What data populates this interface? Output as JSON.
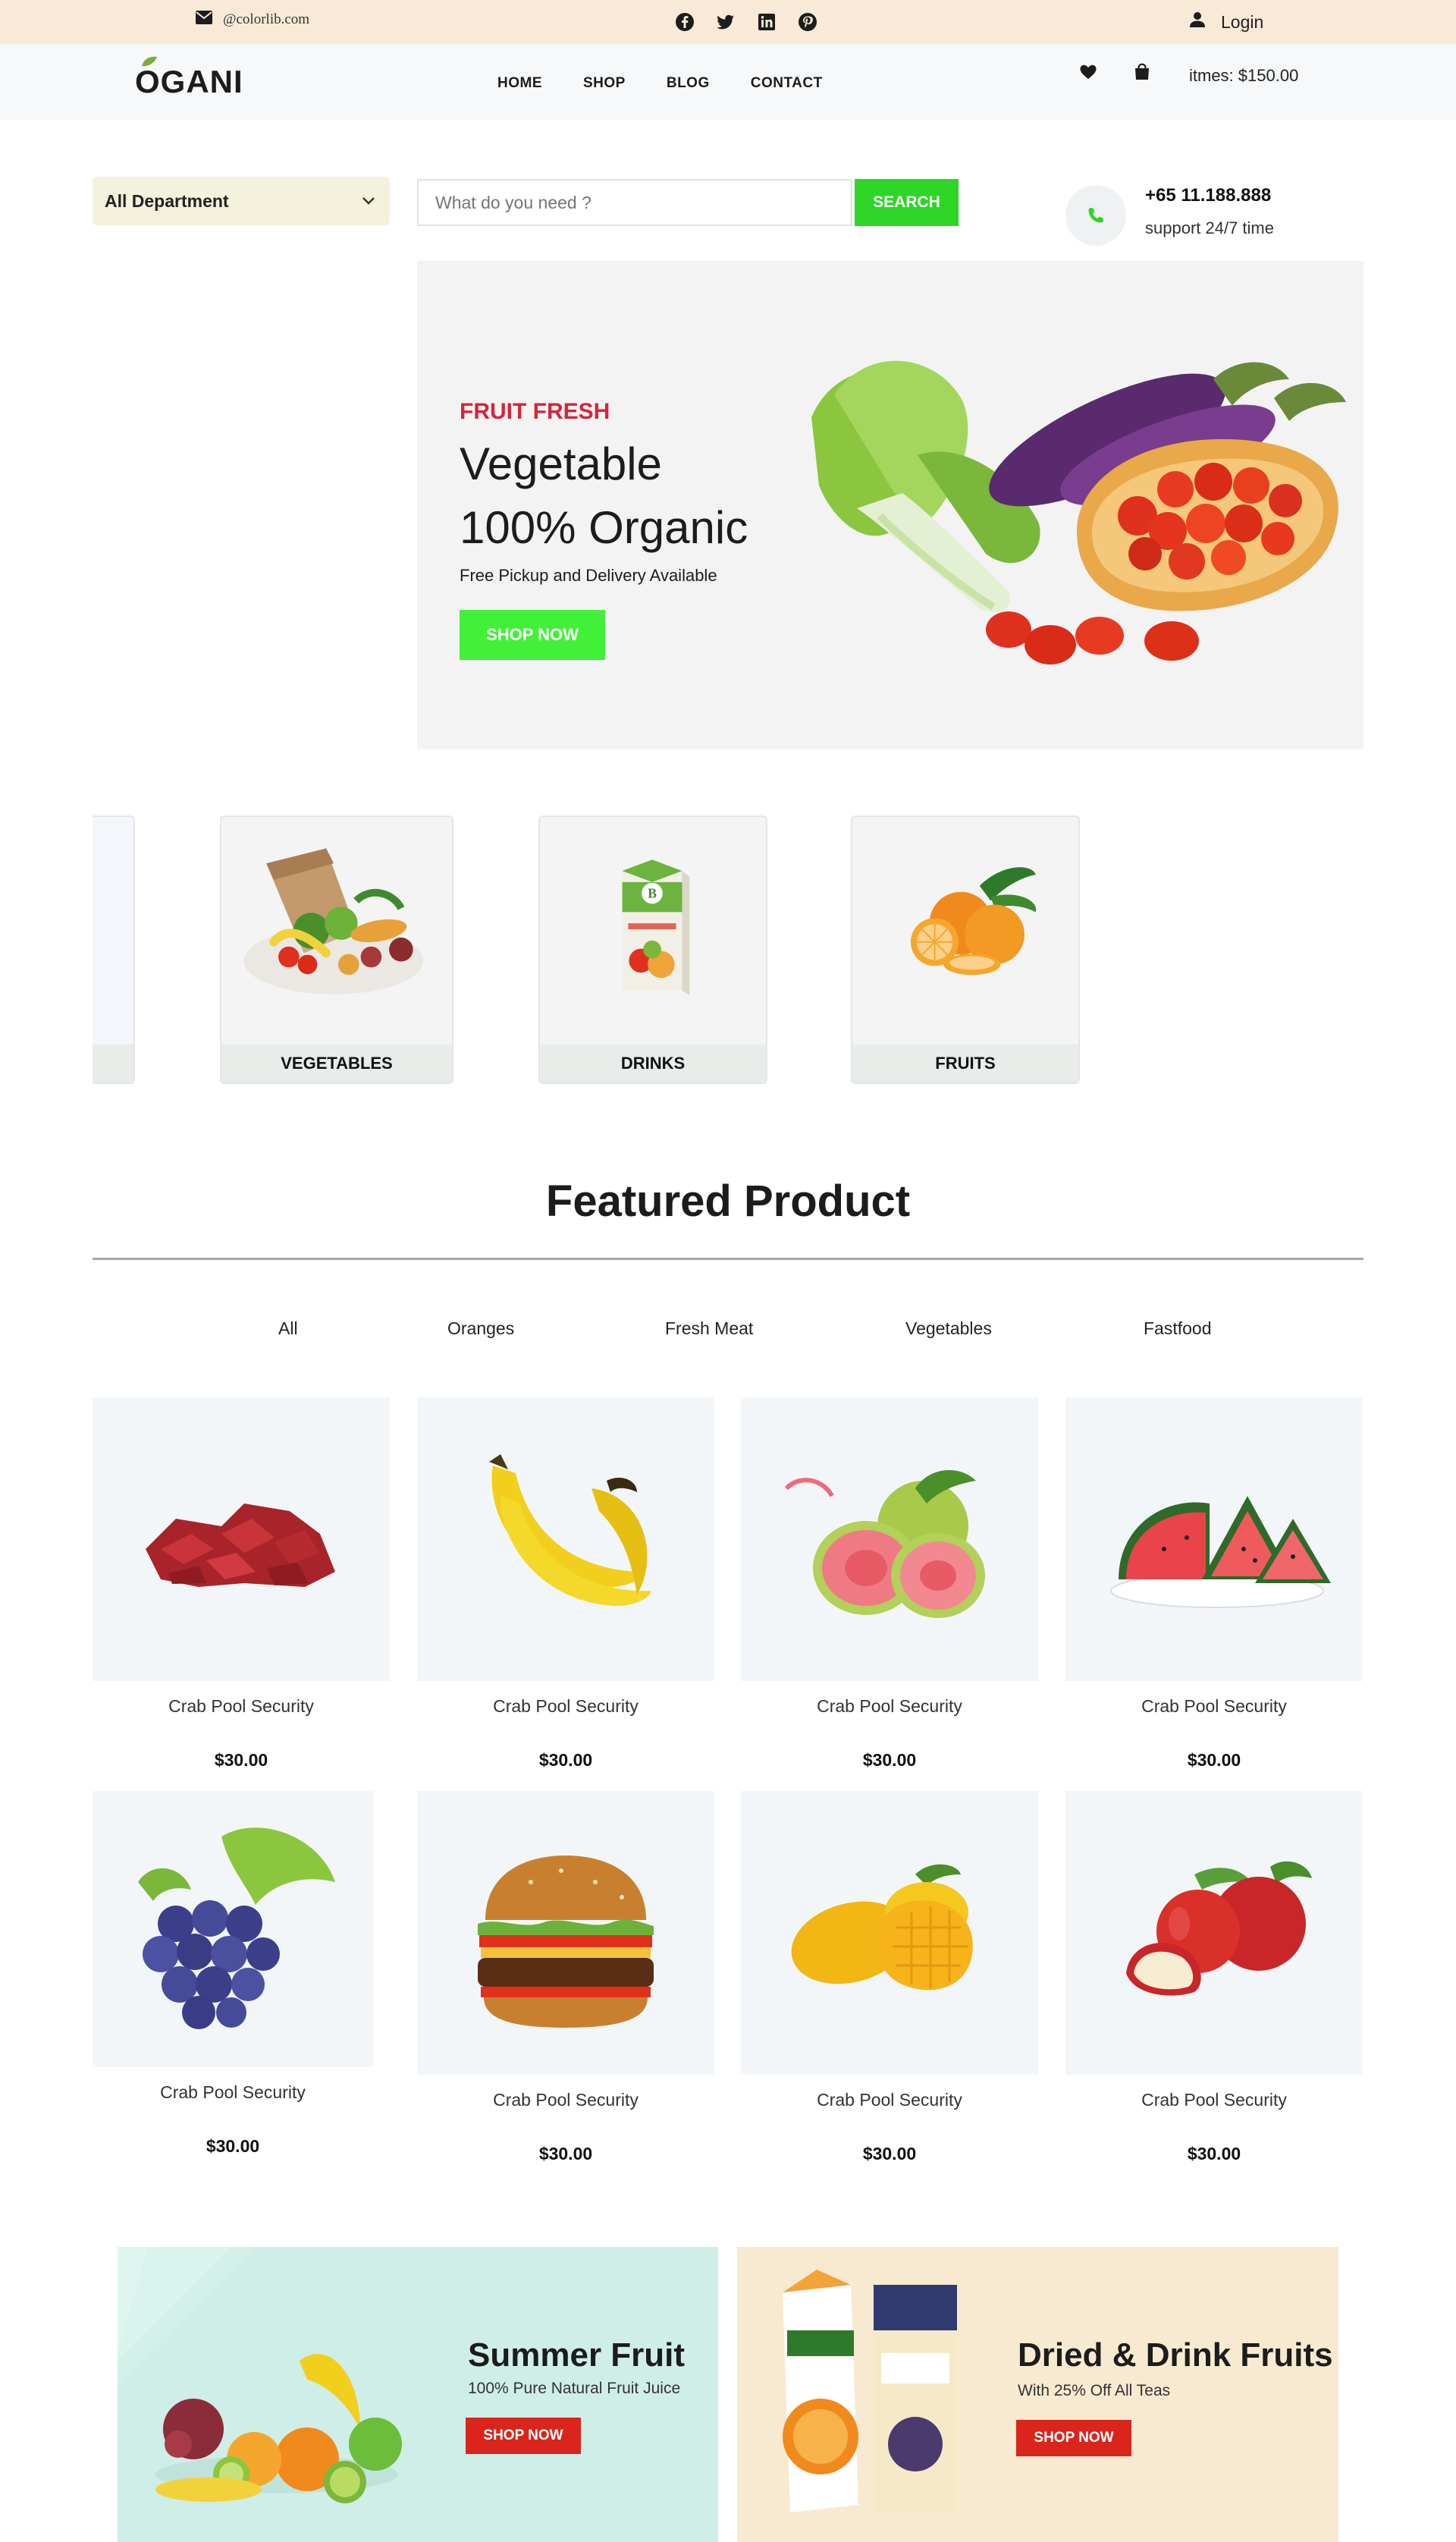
{
  "topbar": {
    "email": "@colorlib.com",
    "login": "Login"
  },
  "header": {
    "logo": "OGANI",
    "nav": [
      "HOME",
      "SHOP",
      "BLOG",
      "CONTACT"
    ],
    "cart_total": "itmes: $150.00"
  },
  "search": {
    "department": "All Department",
    "placeholder": "What do you need ?",
    "button": "SEARCH",
    "phone": "+65 11.188.888",
    "support": "support 24/7 time"
  },
  "hero": {
    "tag": "FRUIT FRESH",
    "title_line1": "Vegetable",
    "title_line2": "100% Organic",
    "subtitle": "Free Pickup and Delivery Available",
    "button": "SHOP NOW"
  },
  "categories": [
    {
      "label": "",
      "icon": "partial-category-card"
    },
    {
      "label": "VEGETABLES",
      "icon": "vegetable-bag-icon"
    },
    {
      "label": "DRINKS",
      "icon": "juice-carton-icon"
    },
    {
      "label": "FRUITS",
      "icon": "oranges-icon"
    }
  ],
  "featured": {
    "title": "Featured Product",
    "filters": [
      "All",
      "Oranges",
      "Fresh Meat",
      "Vegetables",
      "Fastfood"
    ],
    "products": [
      {
        "name": "Crab Pool Security",
        "price": "$30.00",
        "icon": "meat-icon"
      },
      {
        "name": "Crab Pool Security",
        "price": "$30.00",
        "icon": "banana-icon"
      },
      {
        "name": "Crab Pool Security",
        "price": "$30.00",
        "icon": "guava-icon"
      },
      {
        "name": "Crab Pool Security",
        "price": "$30.00",
        "icon": "watermelon-icon"
      },
      {
        "name": "Crab Pool Security",
        "price": "$30.00",
        "icon": "grapes-icon"
      },
      {
        "name": "Crab Pool Security",
        "price": "$30.00",
        "icon": "burger-icon"
      },
      {
        "name": "Crab Pool Security",
        "price": "$30.00",
        "icon": "mango-icon"
      },
      {
        "name": "Crab Pool Security",
        "price": "$30.00",
        "icon": "apple-icon"
      }
    ]
  },
  "banners": [
    {
      "title": "Summer Fruit",
      "subtitle": "100% Pure Natural Fruit Juice",
      "button": "SHOP NOW"
    },
    {
      "title": "Dried & Drink Fruits",
      "subtitle": "With 25% Off All Teas",
      "button": "SHOP NOW"
    }
  ],
  "colors": {
    "topbar_bg": "#f8ead7",
    "primary_green": "#2fd628",
    "hero_tag_red": "#d6243b",
    "banner_button_red": "#d9251c"
  }
}
